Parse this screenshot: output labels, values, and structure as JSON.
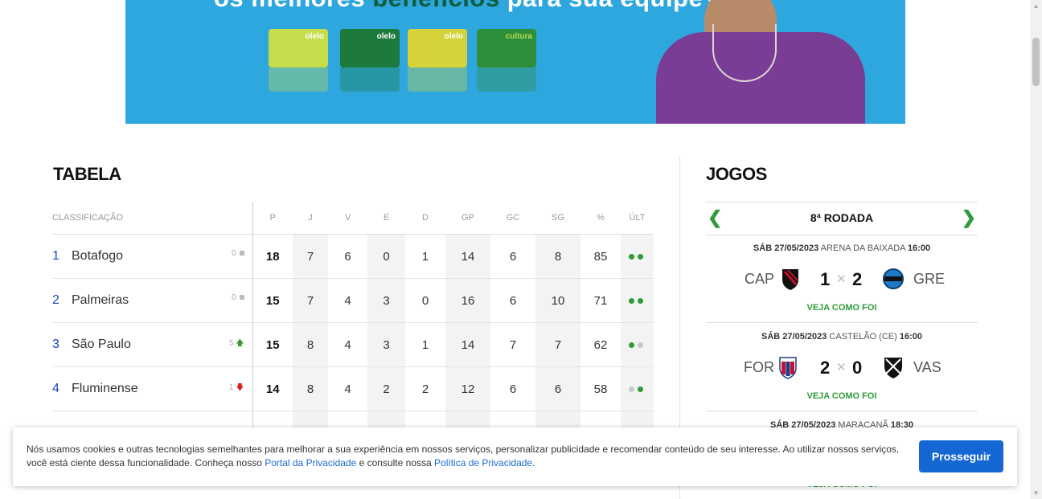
{
  "banner": {
    "headline_part1": "os melhores",
    "headline_highlight": "benefícios",
    "headline_part2": "para sua equipe?",
    "cards": [
      "olelo",
      "olelo",
      "olelo",
      "cultura"
    ]
  },
  "tabela": {
    "title": "TABELA",
    "headers": [
      "CLASSIFICAÇÃO",
      "P",
      "J",
      "V",
      "E",
      "D",
      "GP",
      "GC",
      "SG",
      "%",
      "ÚLT"
    ],
    "rows": [
      {
        "pos": "1",
        "team": "Botafogo",
        "var": "0",
        "var_type": "same",
        "p": "18",
        "j": "7",
        "v": "6",
        "e": "0",
        "d": "1",
        "gp": "14",
        "gc": "6",
        "sg": "8",
        "pct": "85",
        "last": [
          "#2e9c3a",
          "#2e9c3a"
        ]
      },
      {
        "pos": "2",
        "team": "Palmeiras",
        "var": "0",
        "var_type": "same",
        "p": "15",
        "j": "7",
        "v": "4",
        "e": "3",
        "d": "0",
        "gp": "16",
        "gc": "6",
        "sg": "10",
        "pct": "71",
        "last": [
          "#2e9c3a",
          "#2e9c3a"
        ]
      },
      {
        "pos": "3",
        "team": "São Paulo",
        "var": "5",
        "var_type": "up",
        "p": "15",
        "j": "8",
        "v": "4",
        "e": "3",
        "d": "1",
        "gp": "14",
        "gc": "7",
        "sg": "7",
        "pct": "62",
        "last": [
          "#2e9c3a",
          "#c8c8c8"
        ]
      },
      {
        "pos": "4",
        "team": "Fluminense",
        "var": "1",
        "var_type": "down",
        "p": "14",
        "j": "8",
        "v": "4",
        "e": "2",
        "d": "2",
        "gp": "12",
        "gc": "6",
        "sg": "6",
        "pct": "58",
        "last": [
          "#c8c8c8",
          "#2e9c3a"
        ]
      }
    ]
  },
  "jogos": {
    "title": "JOGOS",
    "round": "8ª RODADA",
    "matches": [
      {
        "date": "SÁB 27/05/2023",
        "venue": "ARENA DA BAIXADA",
        "time": "16:00",
        "home": "CAP",
        "home_score": "1",
        "away": "GRE",
        "away_score": "2",
        "cta": "VEJA COMO FOI"
      },
      {
        "date": "SÁB 27/05/2023",
        "venue": "CASTELÃO (CE)",
        "time": "16:00",
        "home": "FOR",
        "home_score": "2",
        "away": "VAS",
        "away_score": "0",
        "cta": "VEJA COMO FOI"
      },
      {
        "date": "SÁB 27/05/2023",
        "venue": "MARACANÃ",
        "time": "18:30",
        "cta": "VEJA COMO FOI"
      }
    ]
  },
  "cookie": {
    "text_1": "Nós usamos cookies e outras tecnologias semelhantes para melhorar a sua experiência em nossos serviços, personalizar publicidade e recomendar conteúdo de seu interesse. Ao utilizar nossos serviços, você está ciente dessa funcionalidade. Conheça nosso ",
    "link_1": "Portal da Privacidade",
    "text_2": " e consulte nossa ",
    "link_2": "Política de Privacidade",
    "text_3": ".",
    "button": "Prosseguir"
  },
  "colors": {
    "accent_green": "#2e9c3a",
    "position_blue": "#1a48c4",
    "button_blue": "#1567d3",
    "banner_blue": "#2ea6de"
  },
  "icons": [
    "chevron-left-icon",
    "chevron-right-icon",
    "arrow-up-icon",
    "arrow-down-icon",
    "team-crest-icon"
  ]
}
